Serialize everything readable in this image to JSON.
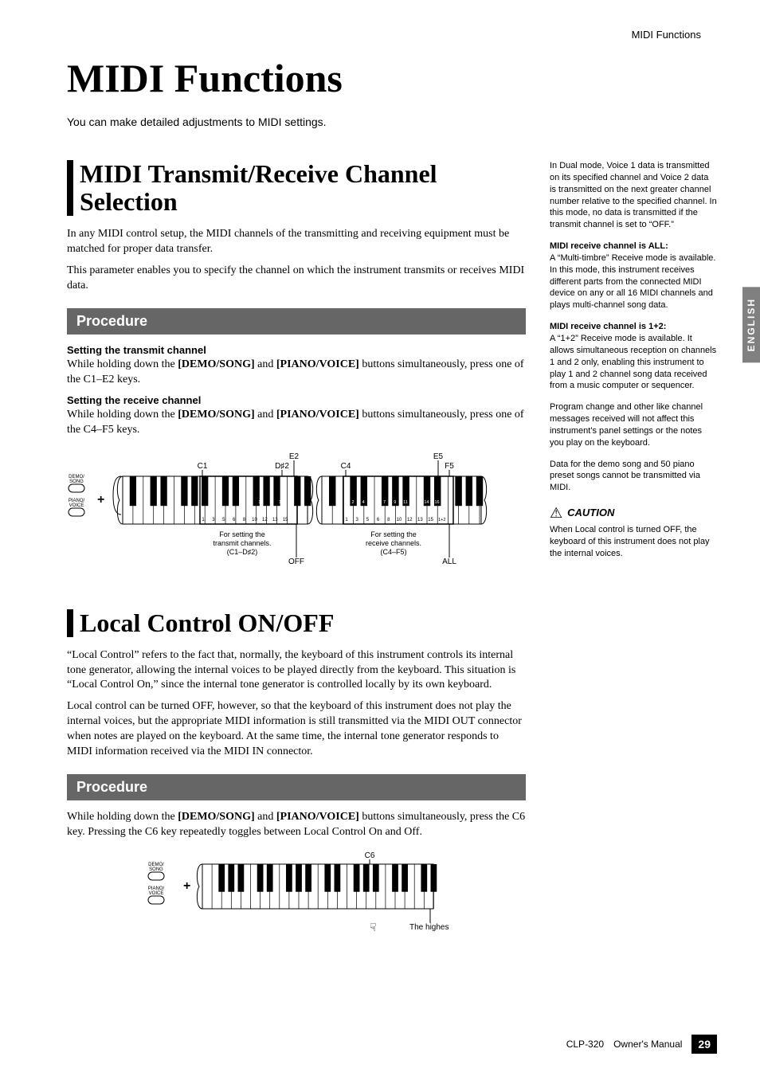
{
  "running_head": "MIDI Functions",
  "title": "MIDI Functions",
  "intro": "You can make detailed adjustments to MIDI settings.",
  "section1": {
    "heading": "MIDI Transmit/Receive Channel Selection",
    "para1": "In any MIDI control setup, the MIDI channels of the transmitting and receiving equipment must be matched for proper data transfer.",
    "para2": "This parameter enables you to specify the channel on which the instrument transmits or receives MIDI data.",
    "procedure_label": "Procedure",
    "tx_heading": "Setting the transmit channel",
    "tx_body_a": "While holding down the ",
    "tx_btn1": "[DEMO/SONG]",
    "tx_mid": " and ",
    "tx_btn2": "[PIANO/VOICE]",
    "tx_body_b": " buttons simultaneously, press one of the C1–E2 keys.",
    "rx_heading": "Setting the receive channel",
    "rx_body_a": "While holding down the ",
    "rx_btn1": "[DEMO/SONG]",
    "rx_mid": " and ",
    "rx_btn2": "[PIANO/VOICE]",
    "rx_body_b": " buttons simultaneously, press one of the C4–F5 keys."
  },
  "fig1": {
    "btn_labels": {
      "demo": "DEMO/\nSONG",
      "piano": "PIANO/\nVOICE"
    },
    "plus": "+",
    "key_labels_top": {
      "C1": "C1",
      "E2": "E2",
      "Dsharp2": "D♯2",
      "C4": "C4",
      "E5": "E5",
      "F5": "F5"
    },
    "numbers_black": [
      "2",
      "4",
      "7",
      "9",
      "11",
      "14",
      "16"
    ],
    "numbers_white": [
      "1",
      "3",
      "5",
      "6",
      "8",
      "10",
      "12",
      "13",
      "15"
    ],
    "rx_extra": "1+2",
    "tx_caption1": "For setting the",
    "tx_caption2": "transmit channels.",
    "tx_caption3": "(C1–D♯2)",
    "rx_caption1": "For setting the",
    "rx_caption2": "receive channels.",
    "rx_caption3": "(C4–F5)",
    "off": "OFF",
    "all": "ALL"
  },
  "section2": {
    "heading": "Local Control ON/OFF",
    "para1": "“Local Control” refers to the fact that, normally, the keyboard of this instrument controls its internal tone generator, allowing the internal voices to be played directly from the keyboard. This situation is “Local Control On,” since the internal tone generator is controlled locally by its own keyboard.",
    "para2": "Local control can be turned OFF, however, so that the keyboard of this instrument does not play the internal voices, but the appropriate MIDI information is still transmitted via the MIDI OUT connector when notes are played on the keyboard. At the same time, the internal tone generator responds to MIDI information received via the MIDI IN connector.",
    "procedure_label": "Procedure",
    "proc_body_a": "While holding down the ",
    "proc_btn1": "[DEMO/SONG]",
    "proc_mid": " and ",
    "proc_btn2": "[PIANO/VOICE]",
    "proc_body_b": " buttons simultaneously, press the C6 key. Pressing the C6 key repeatedly toggles between Local Control On and Off."
  },
  "fig2": {
    "C6": "C6",
    "highest": "The highest key",
    "plus": "+"
  },
  "side": {
    "p1": "In Dual mode, Voice 1 data is transmitted on its specified channel and Voice 2 data is transmitted on the next greater channel number relative to the specified channel. In this mode, no data is transmitted if the transmit channel is set to “OFF.”",
    "h2": "MIDI receive channel is ALL:",
    "p2": "A “Multi-timbre” Receive mode is available. In this mode, this instrument receives different parts from the connected MIDI device on any or all 16 MIDI channels and plays multi-channel song data.",
    "h3": "MIDI receive channel is 1+2:",
    "p3": "A “1+2” Receive mode is available. It allows simultaneous reception on channels 1 and 2 only, enabling this instrument to play 1 and 2 channel song data received from a music computer or sequencer.",
    "p4": "Program change and other like channel messages received will not affect this instrument's panel settings or the notes you play on the keyboard.",
    "p5": "Data for the demo song and 50 piano preset songs cannot be transmitted via MIDI.",
    "caution_label": "CAUTION",
    "caution_body": "When Local control is turned OFF, the keyboard of this instrument does not play the internal voices."
  },
  "tab": "ENGLISH",
  "footer": {
    "model": "CLP-320",
    "doc": "Owner's Manual",
    "page": "29"
  }
}
